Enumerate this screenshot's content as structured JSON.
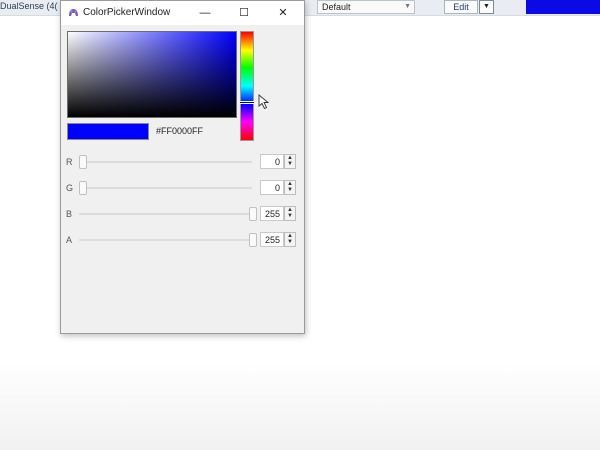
{
  "background_app": {
    "left_label": "DualSense (4(",
    "preset_select": {
      "value": "Default"
    },
    "edit_button": {
      "label": "Edit"
    },
    "accent_color": "#0a0ae6"
  },
  "dialog": {
    "title": "ColorPickerWindow",
    "controls": {
      "minimize": "—",
      "maximize": "☐",
      "close": "✕"
    },
    "selected_color": "#0000ff",
    "hex_value": "#FF0000FF",
    "hue_fraction": 0.65,
    "channels": [
      {
        "label": "R",
        "value": "0",
        "fraction": 0.0
      },
      {
        "label": "G",
        "value": "0",
        "fraction": 0.0
      },
      {
        "label": "B",
        "value": "255",
        "fraction": 1.0
      },
      {
        "label": "A",
        "value": "255",
        "fraction": 1.0
      }
    ],
    "spinner_glyphs": {
      "up": "▲",
      "down": "▼"
    }
  }
}
